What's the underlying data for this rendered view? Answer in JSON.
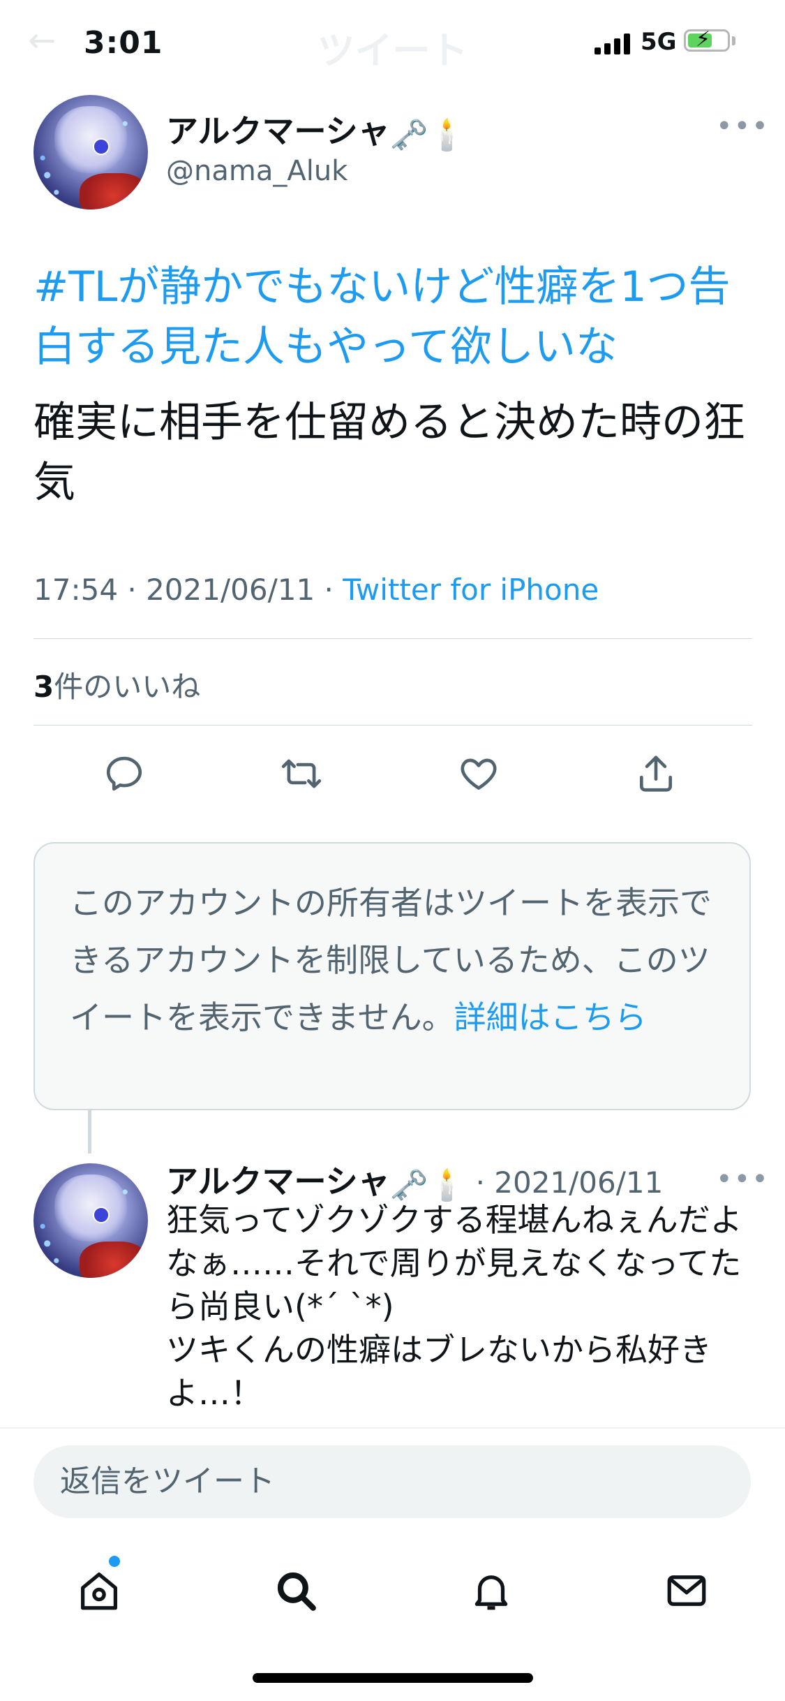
{
  "status_bar": {
    "time": "3:01",
    "network": "5G",
    "icons": [
      "signal-icon",
      "battery-charging-icon"
    ]
  },
  "header_ghost": {
    "back_icon": "back-arrow-icon",
    "title": "ツイート"
  },
  "tweet": {
    "author": {
      "name": "アルクマーシャ",
      "name_emojis": [
        "🗝️",
        "🕯️"
      ],
      "handle": "@nama_Aluk"
    },
    "hashtag_text": "#TLが静かでもないけど性癖を1つ告白する見た人もやって欲しいな",
    "body": "確実に相手を仕留めると決めた時の狂気",
    "timestamp": "17:54 · 2021/06/11 · ",
    "source": "Twitter for iPhone",
    "likes_count": "3",
    "likes_label": "件のいいね",
    "actions": [
      "reply-icon",
      "retweet-icon",
      "like-icon",
      "share-icon"
    ]
  },
  "restricted_notice": {
    "text": "このアカウントの所有者はツイートを表示できるアカウントを制限しているため、このツイートを表示できません。",
    "link": "詳細はこちら"
  },
  "reply": {
    "author_name": "アルクマーシャ",
    "name_emojis": [
      "🗝️",
      "🕯️"
    ],
    "date": " · 2021/06/11",
    "text": "狂気ってゾクゾクする程堪んねぇんだよなぁ……それで周りが見えなくなってたら尚良い(*´ `*)\nツキくんの性癖はブレないから私好きよ…！"
  },
  "composer": {
    "placeholder": "返信をツイート"
  },
  "tab_bar": [
    "home-icon",
    "search-icon",
    "notifications-icon",
    "messages-icon"
  ],
  "colors": {
    "accent": "#1d9bf0",
    "text": "#0f1419",
    "secondary": "#536471"
  }
}
